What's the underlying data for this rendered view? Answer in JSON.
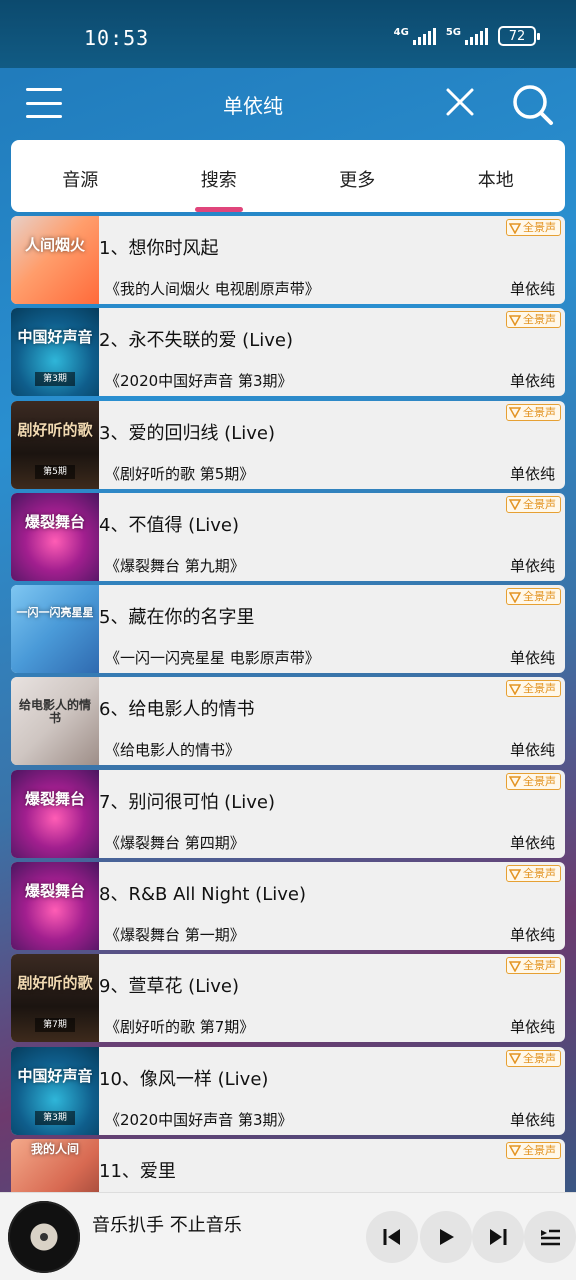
{
  "status_bar": {
    "time": "10:53",
    "network_1": "4G",
    "network_2": "5G",
    "battery": "72"
  },
  "header": {
    "title": "单依纯",
    "icons": [
      "menu-icon",
      "close-icon",
      "search-icon"
    ]
  },
  "tabs": [
    {
      "label": "音源"
    },
    {
      "label": "搜索",
      "active": true
    },
    {
      "label": "更多"
    },
    {
      "label": "本地"
    }
  ],
  "badge_label": "全景声",
  "songs": [
    {
      "title": "1、想你时风起",
      "album": "《我的人间烟火 电视剧原声带》",
      "artist": "单依纯",
      "cover_text": "人间烟火"
    },
    {
      "title": "2、永不失联的爱 (Live)",
      "album": "《2020中国好声音 第3期》",
      "artist": "单依纯",
      "cover_text": "中国好声音",
      "cover_episode": "第3期"
    },
    {
      "title": "3、爱的回归线 (Live)",
      "album": "《剧好听的歌 第5期》",
      "artist": "单依纯",
      "cover_text": "剧好听的歌",
      "cover_episode": "第5期"
    },
    {
      "title": "4、不值得 (Live)",
      "album": "《爆裂舞台 第九期》",
      "artist": "单依纯",
      "cover_text": "爆裂舞台"
    },
    {
      "title": "5、藏在你的名字里",
      "album": "《一闪一闪亮星星 电影原声带》",
      "artist": "单依纯",
      "cover_text": "一闪一闪亮星星"
    },
    {
      "title": "6、给电影人的情书",
      "album": "《给电影人的情书》",
      "artist": "单依纯",
      "cover_text": "给电影人的情书"
    },
    {
      "title": "7、别问很可怕 (Live)",
      "album": "《爆裂舞台 第四期》",
      "artist": "单依纯",
      "cover_text": "爆裂舞台"
    },
    {
      "title": "8、R&B All Night (Live)",
      "album": "《爆裂舞台 第一期》",
      "artist": "单依纯",
      "cover_text": "爆裂舞台"
    },
    {
      "title": "9、萱草花 (Live)",
      "album": "《剧好听的歌 第7期》",
      "artist": "单依纯",
      "cover_text": "剧好听的歌",
      "cover_episode": "第7期"
    },
    {
      "title": "10、像风一样 (Live)",
      "album": "《2020中国好声音 第3期》",
      "artist": "单依纯",
      "cover_text": "中国好声音",
      "cover_episode": "第3期"
    },
    {
      "title": "11、爱里",
      "album": "",
      "artist": "",
      "cover_text": "我的人间"
    }
  ],
  "player": {
    "now_playing": "音乐扒手 不止音乐",
    "icons": [
      "previous-icon",
      "play-icon",
      "next-icon",
      "playlist-icon"
    ]
  }
}
